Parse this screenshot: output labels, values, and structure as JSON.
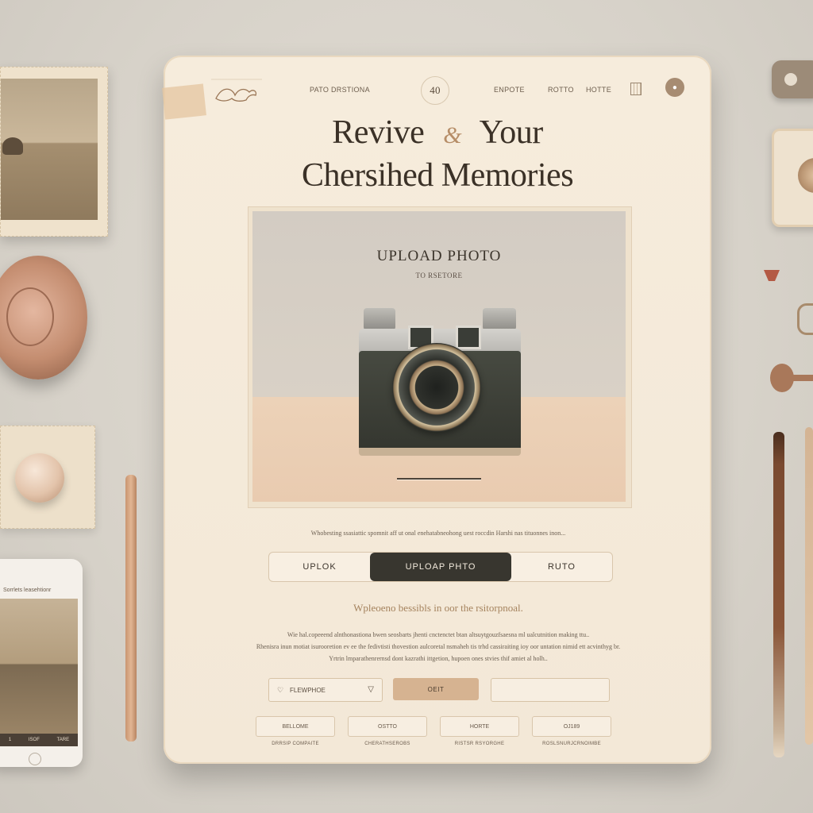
{
  "nav": {
    "brand": "PATO DRSTIONA",
    "page_number": "40",
    "link_1": "ENPOTE",
    "link_2": "ROTTO",
    "link_3": "HOTTE"
  },
  "hero": {
    "title_line1_left": "Revive",
    "title_swirl": "&",
    "title_line1_right": "Your",
    "title_line2": "Chersihed Memories"
  },
  "upload": {
    "heading": "UPLOAD PHOTO",
    "subheading": "TO RSETORE"
  },
  "description_1": "Whobesting ssasiattic spomnit aff ut onal enehatabneohong uest roccdin Harshi nas tituonnes inon...",
  "tabs": [
    {
      "label": "UPLOK"
    },
    {
      "label": "UPLOAP PHTO"
    },
    {
      "label": "RUTO"
    }
  ],
  "subline": "Wpleoeno bessibls in oor the rsitorpnoal.",
  "paragraph": {
    "line_1": "Wie hal.copeeend alnthonastiona bwen seosbarts jhenti cnctenctet btan altsuytgouzfsaesna ml ualcutnition making ttu..",
    "line_2": "Rhenisra inun motiat isurooretion ev ee the fedivtisti thovestion aulcoretal nsmaheh tis trhd cassiraiting ioy oor untation nimid ett acvinthyg br.",
    "line_3": "Yrtrin lmparathenrernsd dont kazrathi ittgetion, hupoen ones stvies thif amiet al holh.."
  },
  "form": {
    "select_lead_icon": "♡",
    "select_label": "FLEWPHOE",
    "select_chevron": "▽",
    "edit_label": "OEIT"
  },
  "mini_items": [
    {
      "box": "BELLOME",
      "caption": "DRRSIP COMPAITE"
    },
    {
      "box": "OSTTO",
      "caption": "CHERATHSEROBS"
    },
    {
      "box": "HORTE",
      "caption": "RISTSR RSYORGHE"
    },
    {
      "box": "OJ189",
      "caption": "ROSLSNURJCRNOIMBE"
    }
  ],
  "phone": {
    "title": "Sorrlets leasehtionr",
    "bar_1": "1",
    "bar_2": "ISOF",
    "bar_3": "TARE"
  },
  "icons": {
    "logo": "bird-logo-icon",
    "grid": "grid-icon",
    "avatar": "avatar-icon",
    "camera": "camera-image"
  },
  "colors": {
    "tablet_bg": "#f4e9d8",
    "active_tab_bg": "#38362f",
    "edit_button_bg": "#d6b391",
    "accent_gold": "#a5835e"
  }
}
